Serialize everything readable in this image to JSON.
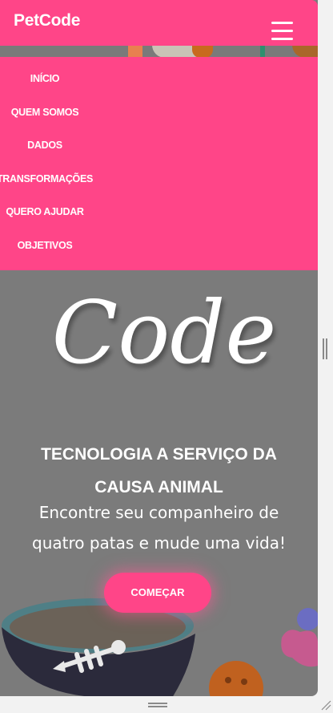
{
  "header": {
    "brand": "PetCode",
    "menu_icon": "hamburger-menu-icon"
  },
  "menu": {
    "items": [
      {
        "label": "INÍCIO"
      },
      {
        "label": "QUEM SOMOS"
      },
      {
        "label": "DADOS"
      },
      {
        "label": "TRANSFORMAÇÕES"
      },
      {
        "label": "QUERO AJUDAR"
      },
      {
        "label": "OBJETIVOS"
      }
    ]
  },
  "hero": {
    "logo_text": "Code",
    "title_line1": "TECNOLOGIA A SERVIÇO DA",
    "title_line2": "CAUSA ANIMAL",
    "subtitle_line1": "Encontre seu companheiro de",
    "subtitle_line2": "quatro patas e mude uma vida!",
    "cta_label": "COMEÇAR"
  },
  "colors": {
    "brand_pink": "#ff4588",
    "hero_bg": "#7b7b7b"
  }
}
